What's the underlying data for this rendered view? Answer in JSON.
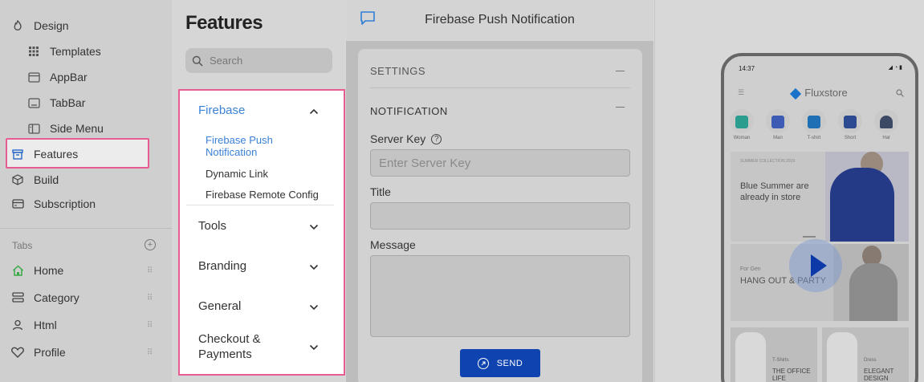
{
  "sidebar": {
    "items": [
      {
        "label": "Design",
        "icon": "palette-icon"
      },
      {
        "label": "Templates",
        "icon": "grid-icon"
      },
      {
        "label": "AppBar",
        "icon": "appbar-icon"
      },
      {
        "label": "TabBar",
        "icon": "tabbar-icon"
      },
      {
        "label": "Side Menu",
        "icon": "side-menu-icon"
      },
      {
        "label": "Features",
        "icon": "archive-icon",
        "selected": true
      },
      {
        "label": "Build",
        "icon": "cube-icon"
      },
      {
        "label": "Subscription",
        "icon": "card-icon"
      }
    ],
    "tabs_label": "Tabs",
    "tabs": [
      {
        "label": "Home",
        "icon": "home-icon",
        "color": "#3aa845"
      },
      {
        "label": "Category",
        "icon": "category-icon"
      },
      {
        "label": "Html",
        "icon": "person-icon"
      },
      {
        "label": "Profile",
        "icon": "heart-icon"
      }
    ]
  },
  "features": {
    "title": "Features",
    "search_placeholder": "Search",
    "groups": [
      {
        "label": "Firebase",
        "expanded": true,
        "children": [
          "Firebase Push Notification",
          "Dynamic Link",
          "Firebase Remote Config"
        ]
      },
      {
        "label": "Tools"
      },
      {
        "label": "Branding"
      },
      {
        "label": "General"
      },
      {
        "label": "Checkout & Payments"
      }
    ]
  },
  "panel": {
    "title": "Firebase Push Notification",
    "settings_label": "SETTINGS",
    "notification_label": "NOTIFICATION",
    "server_key_label": "Server Key",
    "server_key_placeholder": "Enter Server Key",
    "title_label": "Title",
    "message_label": "Message",
    "send_label": "SEND"
  },
  "preview": {
    "time": "14:37",
    "status": "◢ ◔ ▮",
    "brand": "Fluxstore",
    "categories": [
      "Woman",
      "Man",
      "T-shirt",
      "Short",
      "Hat"
    ],
    "banner1_tag": "SUMMER COLLECTION 2019",
    "banner1_text": "Blue Summer are already in store",
    "banner2_tag": "For Gen",
    "banner2_text": "HANG OUT & PARTY",
    "banner3a_tag": "T-Shirts",
    "banner3a_text": "THE OFFICE LIFE",
    "banner3b_tag": "Dress",
    "banner3b_text": "ELEGANT DESIGN"
  },
  "colors": {
    "accent": "#3b82d6",
    "highlight": "#e85c94",
    "send_button": "#0f44b0"
  }
}
